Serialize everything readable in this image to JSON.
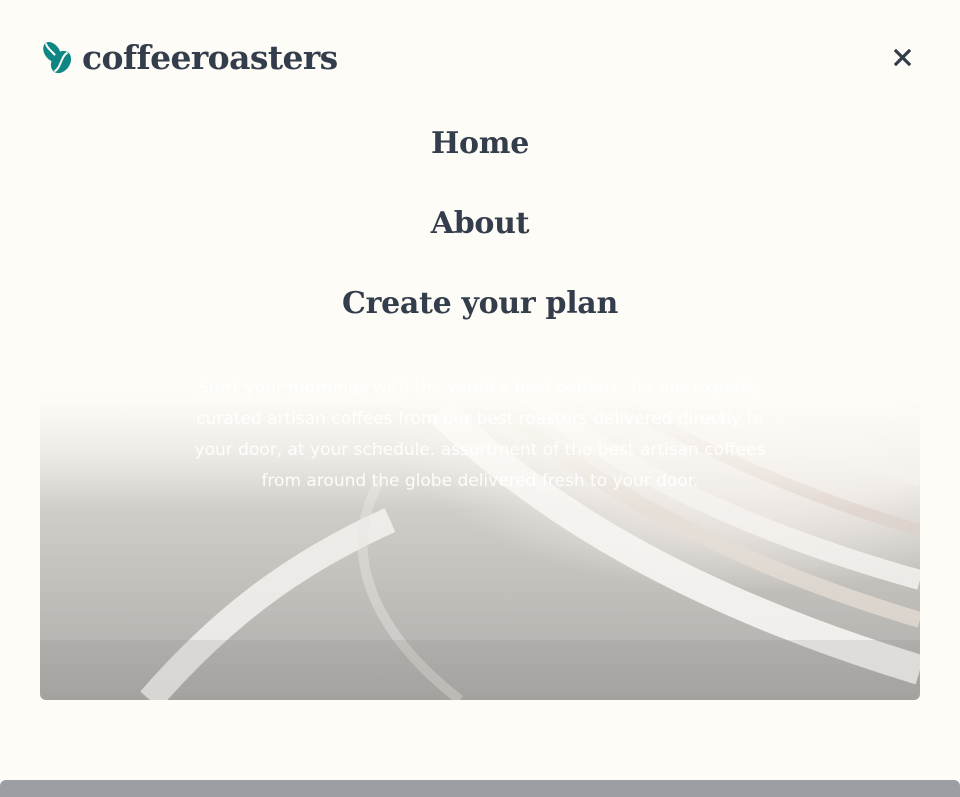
{
  "brand": {
    "name": "coffeeroasters",
    "accent": "#0E8784",
    "text_color": "#333D4B"
  },
  "header": {
    "close_icon": "close-icon"
  },
  "nav": {
    "items": [
      {
        "label": "Home"
      },
      {
        "label": "About"
      },
      {
        "label": "Create your plan"
      }
    ]
  },
  "hero": {
    "description": "Start your mornings with the world’s best coffees. Try our expertly curated artisan coffees from our best roasters delivered directly to your door, at your schedule. assortment of the best artisan coffees from around the globe delivered fresh to your door."
  }
}
